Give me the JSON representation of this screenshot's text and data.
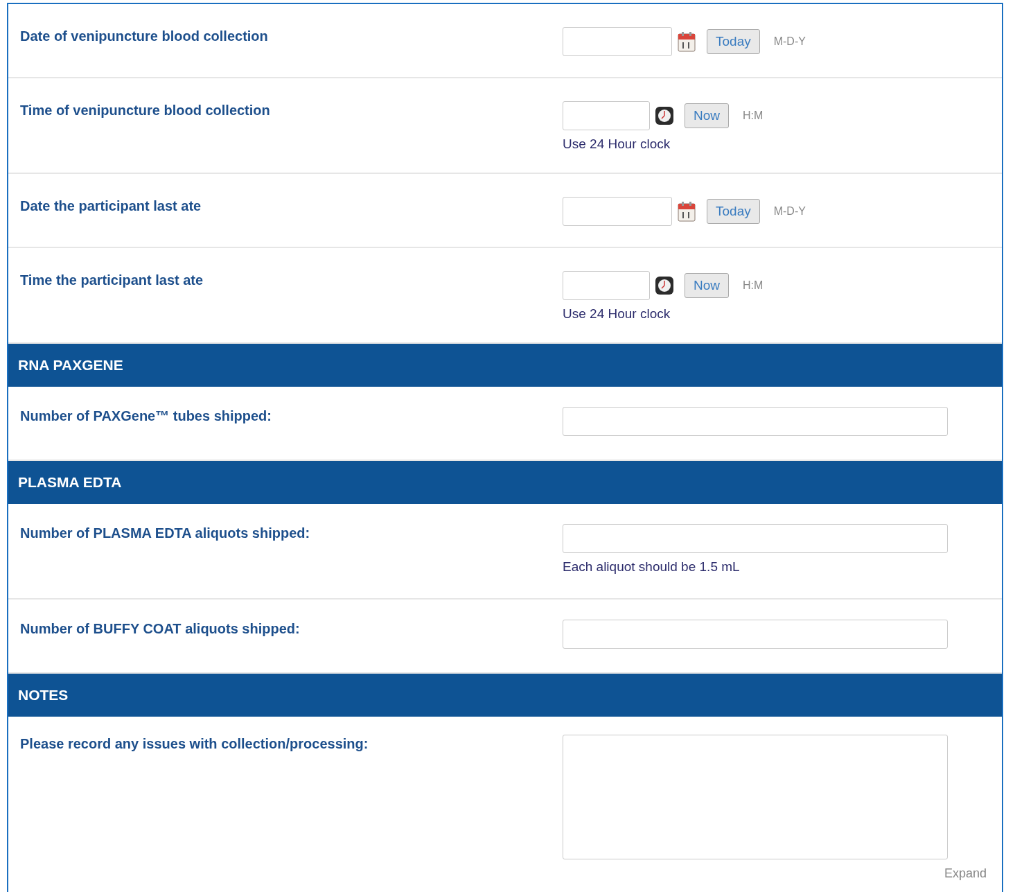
{
  "rows": [
    {
      "kind": "date",
      "label": "Date of venipuncture blood collection",
      "button": "Today",
      "format": "M-D-Y"
    },
    {
      "kind": "time",
      "label": "Time of venipuncture blood collection",
      "button": "Now",
      "format": "H:M",
      "note": "Use 24 Hour clock"
    },
    {
      "kind": "date",
      "label": "Date the participant last ate",
      "button": "Today",
      "format": "M-D-Y"
    },
    {
      "kind": "time",
      "label": "Time the participant last ate",
      "button": "Now",
      "format": "H:M",
      "note": "Use 24 Hour clock"
    },
    {
      "kind": "header",
      "label": "RNA PAXGENE"
    },
    {
      "kind": "number",
      "label": "Number of PAXGene™ tubes shipped:"
    },
    {
      "kind": "header",
      "label": "PLASMA EDTA"
    },
    {
      "kind": "number",
      "label": "Number of PLASMA EDTA aliquots shipped:",
      "note": "Each aliquot should be 1.5 mL"
    },
    {
      "kind": "number",
      "label": "Number of BUFFY COAT aliquots shipped:"
    },
    {
      "kind": "header",
      "label": "NOTES"
    },
    {
      "kind": "notes",
      "label": "Please record any issues with collection/processing:",
      "link": "Expand"
    }
  ]
}
